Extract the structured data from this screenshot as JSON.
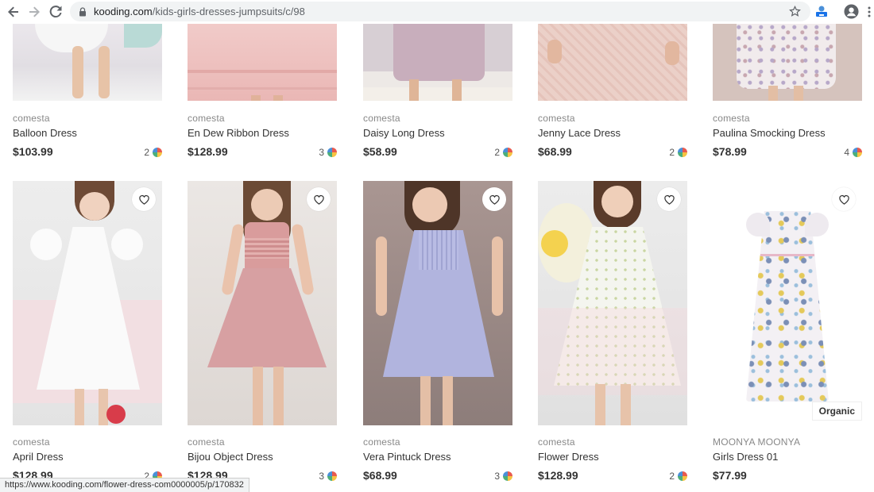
{
  "browser": {
    "url_domain": "kooding.com",
    "url_path": "/kids-girls-dresses-jumpsuits/c/98",
    "status_url": "https://www.kooding.com/flower-dress-com0000005/p/170832"
  },
  "products_row1": [
    {
      "brand": "comesta",
      "name": "Balloon Dress",
      "price": "$103.99",
      "colors": "2",
      "img_top": "#e9e6ea",
      "img_mid": "#dcd9df",
      "img_bottom": "#f1f1f1",
      "dress": "#f4f4f4"
    },
    {
      "brand": "comesta",
      "name": "En Dew Ribbon Dress",
      "price": "$128.99",
      "colors": "3",
      "img_top": "#f1c8c6",
      "img_mid": "#efc2c0",
      "img_bottom": "#eab9b7",
      "dress": "#f3cac8"
    },
    {
      "brand": "comesta",
      "name": "Daisy Long Dress",
      "price": "$58.99",
      "colors": "2",
      "img_top": "#cdb9c6",
      "img_mid": "#c8b2bf",
      "img_bottom": "#e8e3df",
      "dress": "#c7a9b9"
    },
    {
      "brand": "comesta",
      "name": "Jenny Lace Dress",
      "price": "$68.99",
      "colors": "2",
      "img_top": "#ebcfc7",
      "img_mid": "#e9c8bf",
      "img_bottom": "#e7c4ba",
      "dress": "#ecd0c7"
    },
    {
      "brand": "comesta",
      "name": "Paulina Smocking Dress",
      "price": "$78.99",
      "colors": "4",
      "img_top": "#efe9e7",
      "img_mid": "#e7dcd9",
      "img_bottom": "#d9c7c2",
      "dress": "#efe7ea"
    }
  ],
  "products_row2": [
    {
      "brand": "comesta",
      "name": "April Dress",
      "price": "$128.99",
      "colors": "2",
      "bg": "#ececec",
      "dress": "#f8f8f8",
      "accent": "#f0d9dc"
    },
    {
      "brand": "comesta",
      "name": "Bijou Object Dress",
      "price": "$128.99",
      "colors": "3",
      "bg": "#e7e3e0",
      "dress": "#d99a9a",
      "accent": "#f2d2cd"
    },
    {
      "brand": "comesta",
      "name": "Vera Pintuck Dress",
      "price": "$68.99",
      "colors": "3",
      "bg": "#9b8c89",
      "dress": "#aeb2dd",
      "accent": "#8a7c79"
    },
    {
      "brand": "comesta",
      "name": "Flower Dress",
      "price": "$128.99",
      "colors": "2",
      "bg": "#e8e8e8",
      "dress": "#f2f4ee",
      "accent": "#f5e36a"
    },
    {
      "brand": "MOONYA MOONYA",
      "name": "Girls Dress 01",
      "price": "$77.99",
      "colors": "",
      "bg": "#ffffff",
      "dress": "#f1eef3",
      "accent": "#7b8fb6",
      "badge": "Organic"
    }
  ]
}
